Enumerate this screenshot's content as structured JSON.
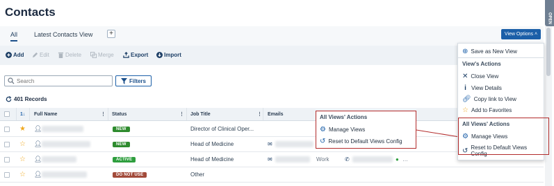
{
  "page_title": "Contacts",
  "tabs": [
    {
      "label": "All"
    },
    {
      "label": "Latest Contacts View"
    },
    {
      "label": "+"
    }
  ],
  "view_options_label": "View Options ˄",
  "open_tab_label": "OPEN",
  "toolbar": {
    "add": "Add",
    "edit": "Edit",
    "delete": "Delete",
    "merge": "Merge",
    "export": "Export",
    "import": "Import"
  },
  "search": {
    "placeholder": "Search"
  },
  "filters_label": "Filters",
  "records_label": "401 Records",
  "columns": {
    "sort": "1↓",
    "full_name": "Full Name",
    "status": "Status",
    "job_title": "Job Title",
    "emails": "Emails"
  },
  "rows": [
    {
      "status": "NEW",
      "status_color": "#2e8b2e",
      "job_title": "Director of Clinical Oper...",
      "starred": true
    },
    {
      "status": "NEW",
      "status_color": "#2e8b2e",
      "job_title": "Head of Medicine",
      "starred": false
    },
    {
      "status": "ACTIVE",
      "status_color": "#2e9e3e",
      "job_title": "Head of Medicine",
      "starred": false,
      "phone_type": "Work"
    },
    {
      "status": "DO NOT USE",
      "status_color": "#a24a3a",
      "job_title": "Other",
      "starred": false
    }
  ],
  "popup": {
    "title": "All Views' Actions",
    "manage": "Manage Views",
    "reset": "Reset to Default Views Config"
  },
  "menu": {
    "save_as_new": "Save as New View",
    "views_actions_title": "View's Actions",
    "close_view": "Close View",
    "view_details": "View Details",
    "copy_link": "Copy link to View",
    "add_favorites": "Add to Favorites",
    "all_views_title": "All Views' Actions",
    "manage_views": "Manage Views",
    "reset_default": "Reset to Default Views Config"
  },
  "colors": {
    "accent": "#1b5fa8",
    "highlight": "#b22a2a",
    "star": "#f0a81e"
  }
}
